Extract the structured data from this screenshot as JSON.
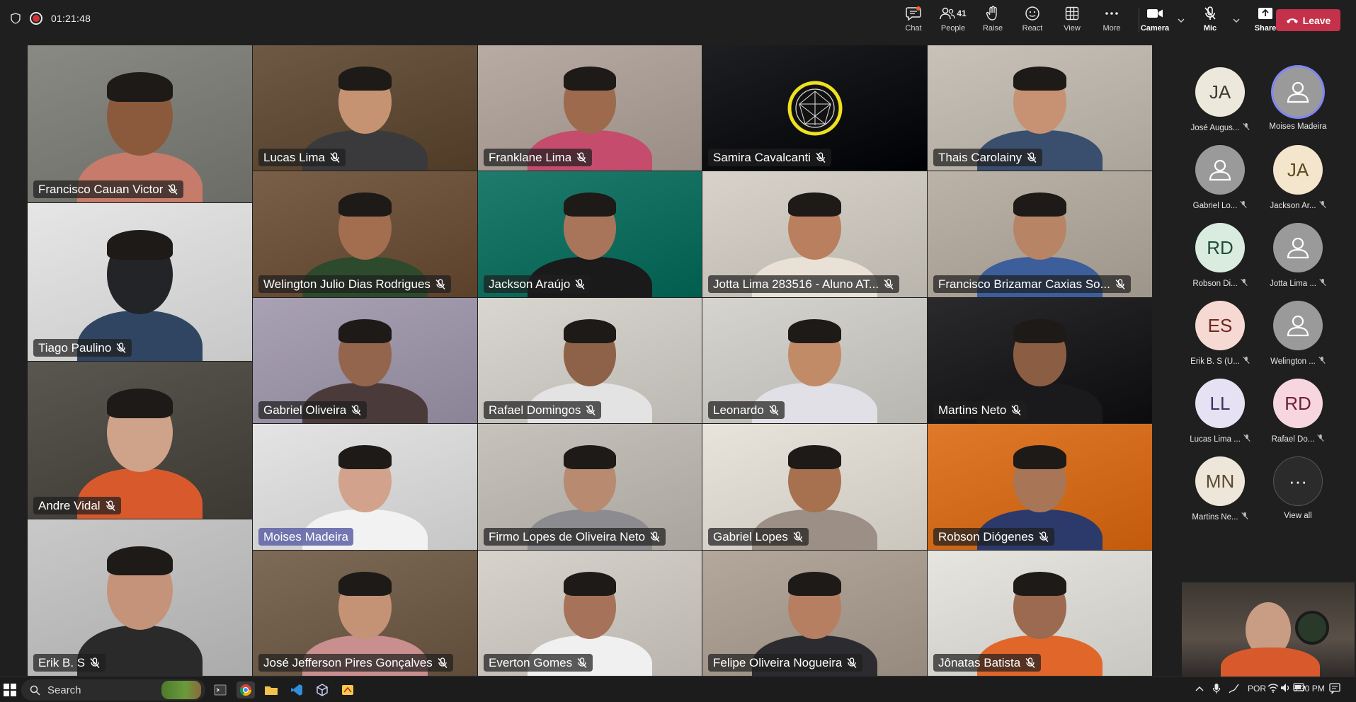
{
  "call": {
    "timer": "01:21:48",
    "toolbar": [
      {
        "id": "chat",
        "label": "Chat",
        "icon": "chat-icon",
        "glyph": "☉"
      },
      {
        "id": "people",
        "label": "People",
        "icon": "people-icon",
        "glyph": "☺",
        "count": "41"
      },
      {
        "id": "raise",
        "label": "Raise",
        "icon": "hand-icon",
        "glyph": "✋"
      },
      {
        "id": "react",
        "label": "React",
        "icon": "smiley-icon",
        "glyph": "☺"
      },
      {
        "id": "view",
        "label": "View",
        "icon": "grid-icon",
        "glyph": "▦"
      },
      {
        "id": "more",
        "label": "More",
        "icon": "more-icon",
        "glyph": "···"
      }
    ],
    "camera_label": "Camera",
    "mic_label": "Mic",
    "share_label": "Share",
    "leave_label": "Leave"
  },
  "tiles": [
    {
      "name": "Francisco Cauan Victor",
      "bg": "#8a8a84",
      "skin": "#8b5a3c",
      "shirt": "#c77b6b",
      "muted": true
    },
    {
      "name": "Lucas Lima",
      "bg": "#6e5a44",
      "skin": "#c59372",
      "shirt": "#3a3a3c",
      "muted": true
    },
    {
      "name": "Franklane Lima",
      "bg": "#b7aba3",
      "skin": "#9d6a4e",
      "shirt": "#c54c6c",
      "muted": true
    },
    {
      "name": "Samira Cavalcanti",
      "bg": "#1d1f22",
      "muted": true,
      "logo": true
    },
    {
      "name": "Thais Carolainy",
      "bg": "#c8c2b8",
      "skin": "#c79274",
      "shirt": "#3a4e6e",
      "muted": true
    },
    {
      "name": "Tiago Paulino",
      "bg": "#e6e6e6",
      "skin": "#222428",
      "shirt": "#2f4562",
      "muted": true
    },
    {
      "name": "Welington Julio Dias Rodrigues",
      "bg": "#7a5f48",
      "skin": "#a36d4f",
      "shirt": "#2d4a2c",
      "muted": true
    },
    {
      "name": "Jackson Araújo",
      "bg": "#1f7c6d",
      "skin": "#a8755a",
      "shirt": "#1a1a1a",
      "muted": true
    },
    {
      "name": "Jotta Lima 283516 - Aluno AT...",
      "bg": "#d8d3ca",
      "skin": "#b97f5f",
      "shirt": "#e9e1d6",
      "muted": true
    },
    {
      "name": "Francisco Brizamar Caxias So...",
      "bg": "#bcb3a8",
      "skin": "#b88466",
      "shirt": "#3c5e9b",
      "muted": true
    },
    {
      "name": "Andre Vidal",
      "bg": "#5a5650",
      "skin": "#cfa38a",
      "shirt": "#d85a2c",
      "muted": true
    },
    {
      "name": "Gabriel Oliveira",
      "bg": "#a9a1b4",
      "skin": "#93654c",
      "shirt": "#4a3b3a",
      "muted": true
    },
    {
      "name": "Rafael Domingos",
      "bg": "#d9d6d0",
      "skin": "#8e6248",
      "shirt": "#e3e3e3",
      "muted": true
    },
    {
      "name": "Leonardo",
      "bg": "#d6d4ce",
      "skin": "#c28b68",
      "shirt": "#e0e0e6",
      "muted": true
    },
    {
      "name": "Martins Neto",
      "bg": "#2a2a2c",
      "skin": "#8b5e44",
      "shirt": "#1a1a1c",
      "muted": true
    },
    {
      "name": "Moises Madeira",
      "bg": "#e4e4e4",
      "skin": "#d2a28c",
      "shirt": "#f2f2f2",
      "muted": false,
      "highlight": true
    },
    {
      "name": "Firmo Lopes de Oliveira Neto",
      "bg": "#c7c2bc",
      "skin": "#b88a70",
      "shirt": "#8b8b90",
      "muted": true
    },
    {
      "name": "Gabriel Lopes",
      "bg": "#e8e4dc",
      "skin": "#a7704e",
      "shirt": "#9b8f86",
      "muted": true
    },
    {
      "name": "Robson Diógenes",
      "bg": "#e07a2a",
      "skin": "#a87556",
      "shirt": "#2b3a6a",
      "muted": true
    },
    {
      "name": "Erik B. S",
      "bg": "#c9c9c9",
      "skin": "#c5937a",
      "shirt": "#2a2a2a",
      "muted": true
    },
    {
      "name": "José Jefferson Pires Gonçalves",
      "bg": "#7d6a57",
      "skin": "#c49274",
      "shirt": "#c98e8e",
      "muted": true
    },
    {
      "name": "Everton Gomes",
      "bg": "#d7d3cc",
      "skin": "#a7725a",
      "shirt": "#f0f0f0",
      "muted": true
    },
    {
      "name": "Felipe Oliveira Nogueira",
      "bg": "#b4a89c",
      "skin": "#b77f62",
      "shirt": "#2c2c30",
      "muted": true
    },
    {
      "name": "Jônatas Batista",
      "bg": "#e7e5e0",
      "skin": "#9b6a50",
      "shirt": "#e0662a",
      "muted": true
    }
  ],
  "roster": [
    {
      "initials": "JA",
      "name": "José Augus...",
      "bg": "#ece9dc",
      "fg": "#3b3a30",
      "muted": true
    },
    {
      "initials": "",
      "name": "Moises Madeira",
      "bg": "#9a9a9a",
      "fg": "#ffffff",
      "muted": false,
      "speaking": true
    },
    {
      "initials": "",
      "name": "Gabriel Lo...",
      "bg": "#9a9a9a",
      "fg": "#ffffff",
      "muted": true
    },
    {
      "initials": "JA",
      "name": "Jackson Ar...",
      "bg": "#f3e6cc",
      "fg": "#5e4a1f",
      "muted": true
    },
    {
      "initials": "RD",
      "name": "Robson Di...",
      "bg": "#d9ecdf",
      "fg": "#1f4d33",
      "muted": true
    },
    {
      "initials": "",
      "name": "Jotta Lima ...",
      "bg": "#9a9a9a",
      "fg": "#ffffff",
      "muted": true
    },
    {
      "initials": "ES",
      "name": "Erik B. S (U...",
      "bg": "#f5d9d2",
      "fg": "#6e2a1f",
      "muted": true
    },
    {
      "initials": "",
      "name": "Welington ...",
      "bg": "#9a9a9a",
      "fg": "#ffffff",
      "muted": true
    },
    {
      "initials": "LL",
      "name": "Lucas Lima ...",
      "bg": "#e6e2f3",
      "fg": "#3a3566",
      "muted": true
    },
    {
      "initials": "RD",
      "name": "Rafael Do...",
      "bg": "#f7d6df",
      "fg": "#6a1f36",
      "muted": true
    },
    {
      "initials": "MN",
      "name": "Martins Ne...",
      "bg": "#eee6d9",
      "fg": "#5a4a33",
      "muted": true
    },
    {
      "initials": "···",
      "name": "View all",
      "bg": "#2b2b2b",
      "fg": "#ffffff",
      "muted": false,
      "viewall": true
    }
  ],
  "taskbar": {
    "search_label": "Search",
    "lang": "POR",
    "time": "8:30 PM"
  }
}
